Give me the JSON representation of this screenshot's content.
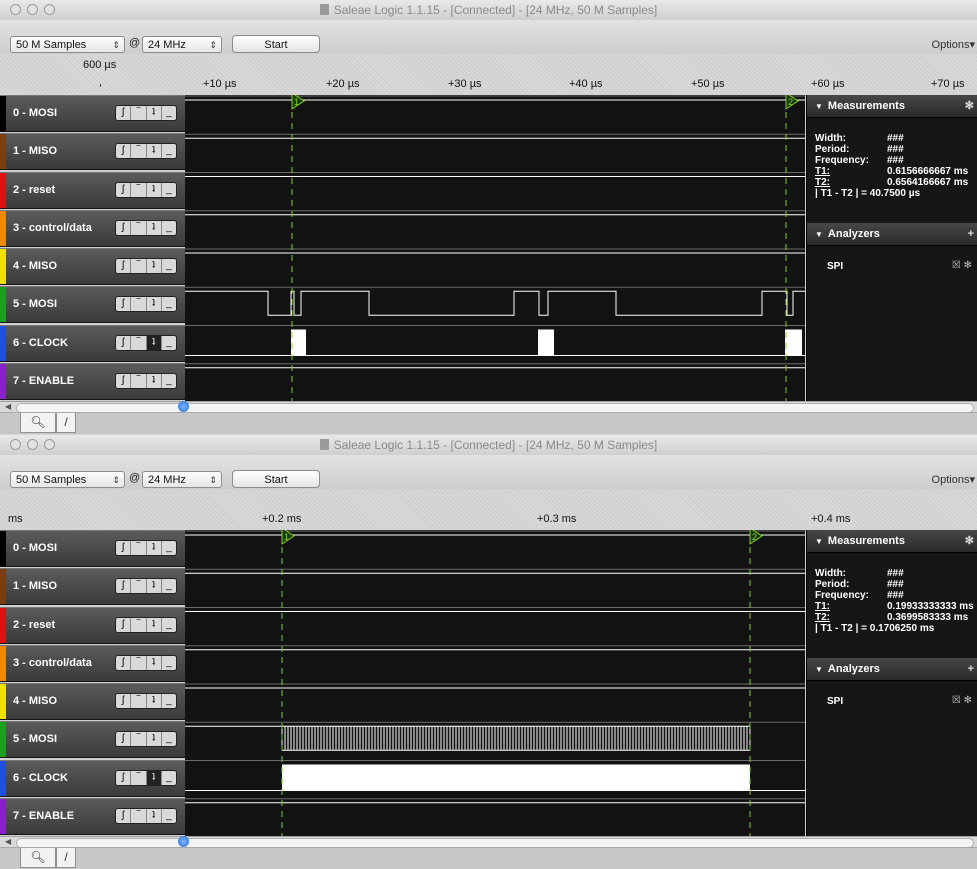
{
  "windows": [
    {
      "title": "Saleae Logic 1.1.15 - [Connected] - [24 MHz, 50 M Samples]",
      "samples": "50 M Samples",
      "at": "@",
      "rate": "24 MHz",
      "start": "Start",
      "options": "Options",
      "ruler_corner": "600 µs",
      "ruler_labels": [
        "+10 µs",
        "+20 µs",
        "+30 µs",
        "+40 µs",
        "+50 µs",
        "+60 µs",
        "+70 µs"
      ],
      "channels": [
        "0 - MOSI",
        "1 - MISO",
        "2 - reset",
        "3 - control/data",
        "4 - MISO",
        "5 - MOSI",
        "6 - CLOCK",
        "7 - ENABLE"
      ],
      "markers": [
        "1",
        "2"
      ],
      "measurements": {
        "title": "Measurements",
        "width_label": "Width:",
        "width_value": "###",
        "period_label": "Period:",
        "period_value": "###",
        "freq_label": "Frequency:",
        "freq_value": "###",
        "t1_label": "T1:",
        "t1_value": "0.6156666667 ms",
        "t2_label": "T2:",
        "t2_value": "0.6564166667 ms",
        "delta": "| T1 - T2 | = 40.7500 µs"
      },
      "analyzers": {
        "title": "Analyzers",
        "items": [
          "SPI"
        ]
      }
    },
    {
      "title": "Saleae Logic 1.1.15 - [Connected] - [24 MHz, 50 M Samples]",
      "samples": "50 M Samples",
      "at": "@",
      "rate": "24 MHz",
      "start": "Start",
      "options": "Options",
      "ruler_corner": "ms",
      "ruler_labels": [
        "+0.2 ms",
        "+0.3 ms",
        "+0.4 ms"
      ],
      "channels": [
        "0 - MOSI",
        "1 - MISO",
        "2 - reset",
        "3 - control/data",
        "4 - MISO",
        "5 - MOSI",
        "6 - CLOCK",
        "7 - ENABLE"
      ],
      "markers": [
        "1",
        "2"
      ],
      "measurements": {
        "title": "Measurements",
        "width_label": "Width:",
        "width_value": "###",
        "period_label": "Period:",
        "period_value": "###",
        "freq_label": "Frequency:",
        "freq_value": "###",
        "t1_label": "T1:",
        "t1_value": "0.19933333333 ms",
        "t2_label": "T2:",
        "t2_value": "0.3699583333 ms",
        "delta": "| T1 - T2 | = 0.1706250 ms"
      },
      "analyzers": {
        "title": "Analyzers",
        "items": [
          "SPI"
        ]
      }
    }
  ],
  "channel_colors": [
    "#000000",
    "#7a3e12",
    "#e01010",
    "#ef8a00",
    "#f0e000",
    "#1aa01a",
    "#1f4fe0",
    "#8a1fd0"
  ],
  "trigger_icons": [
    "rising-edge-icon",
    "high-level-icon",
    "falling-edge-icon",
    "low-level-icon"
  ],
  "colors": {
    "marker": "#7ed321",
    "trace": "#ffffff",
    "wave_bg": "#121212"
  }
}
